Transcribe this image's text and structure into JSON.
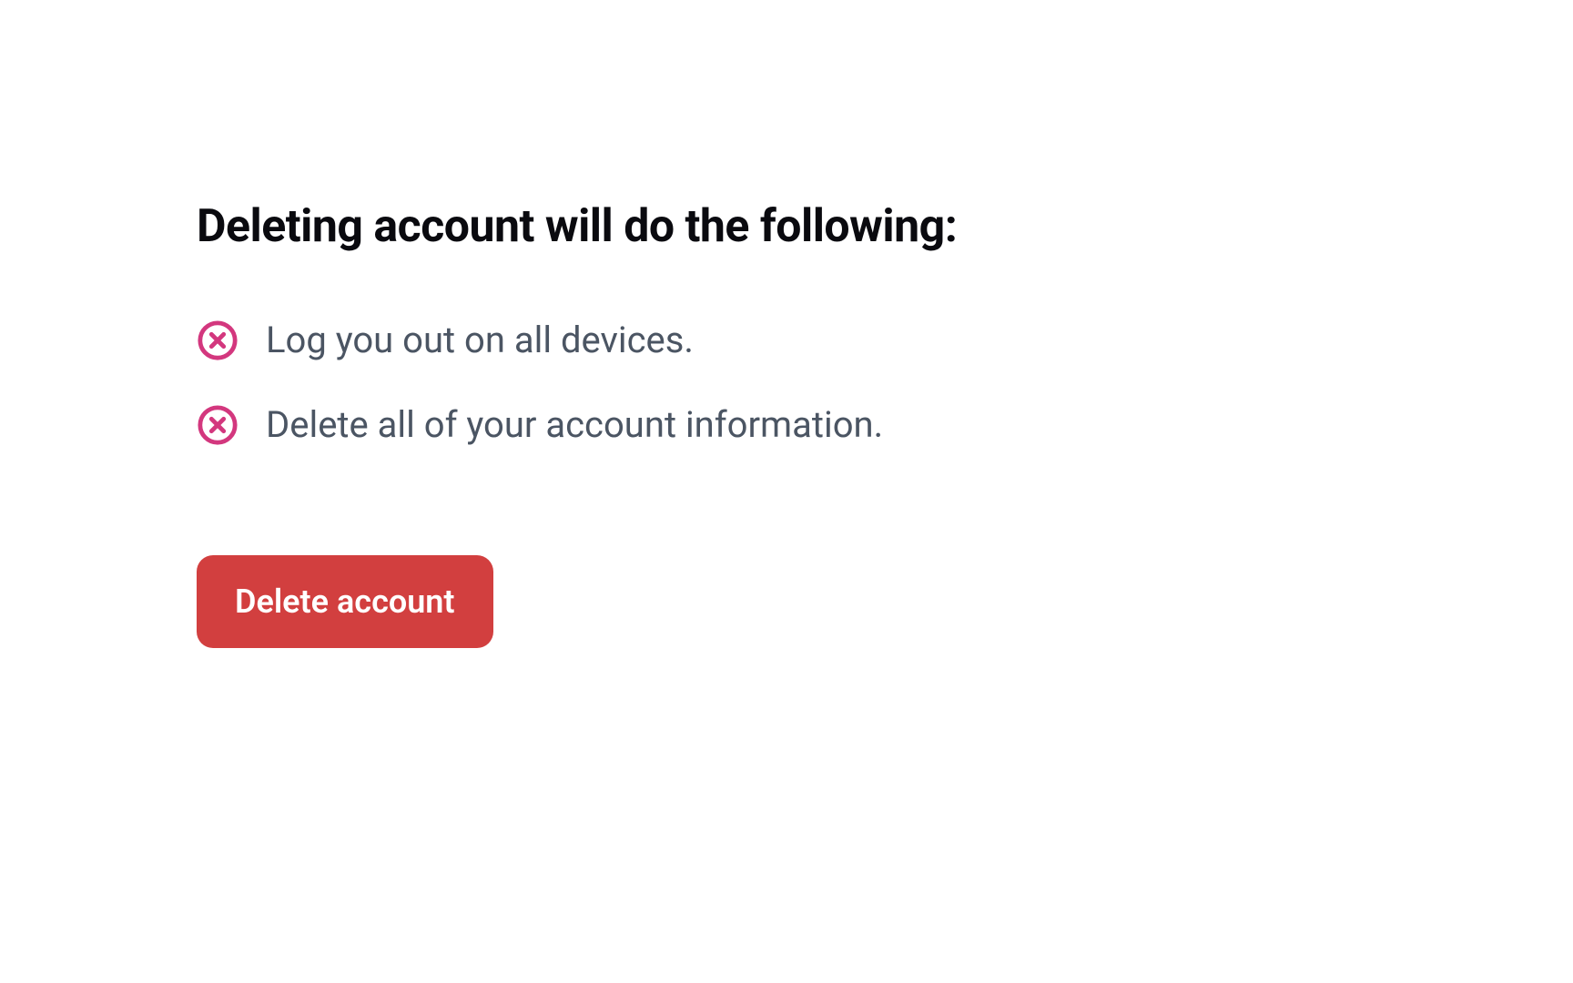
{
  "heading": "Deleting account will do the following:",
  "consequences": [
    "Log you out on all devices.",
    "Delete all of your account information."
  ],
  "button": {
    "label": "Delete account"
  },
  "colors": {
    "icon": "#d3377e",
    "button_bg": "#d23f3f",
    "text_muted": "#4b5563",
    "text_heading": "#0a0a0f"
  }
}
